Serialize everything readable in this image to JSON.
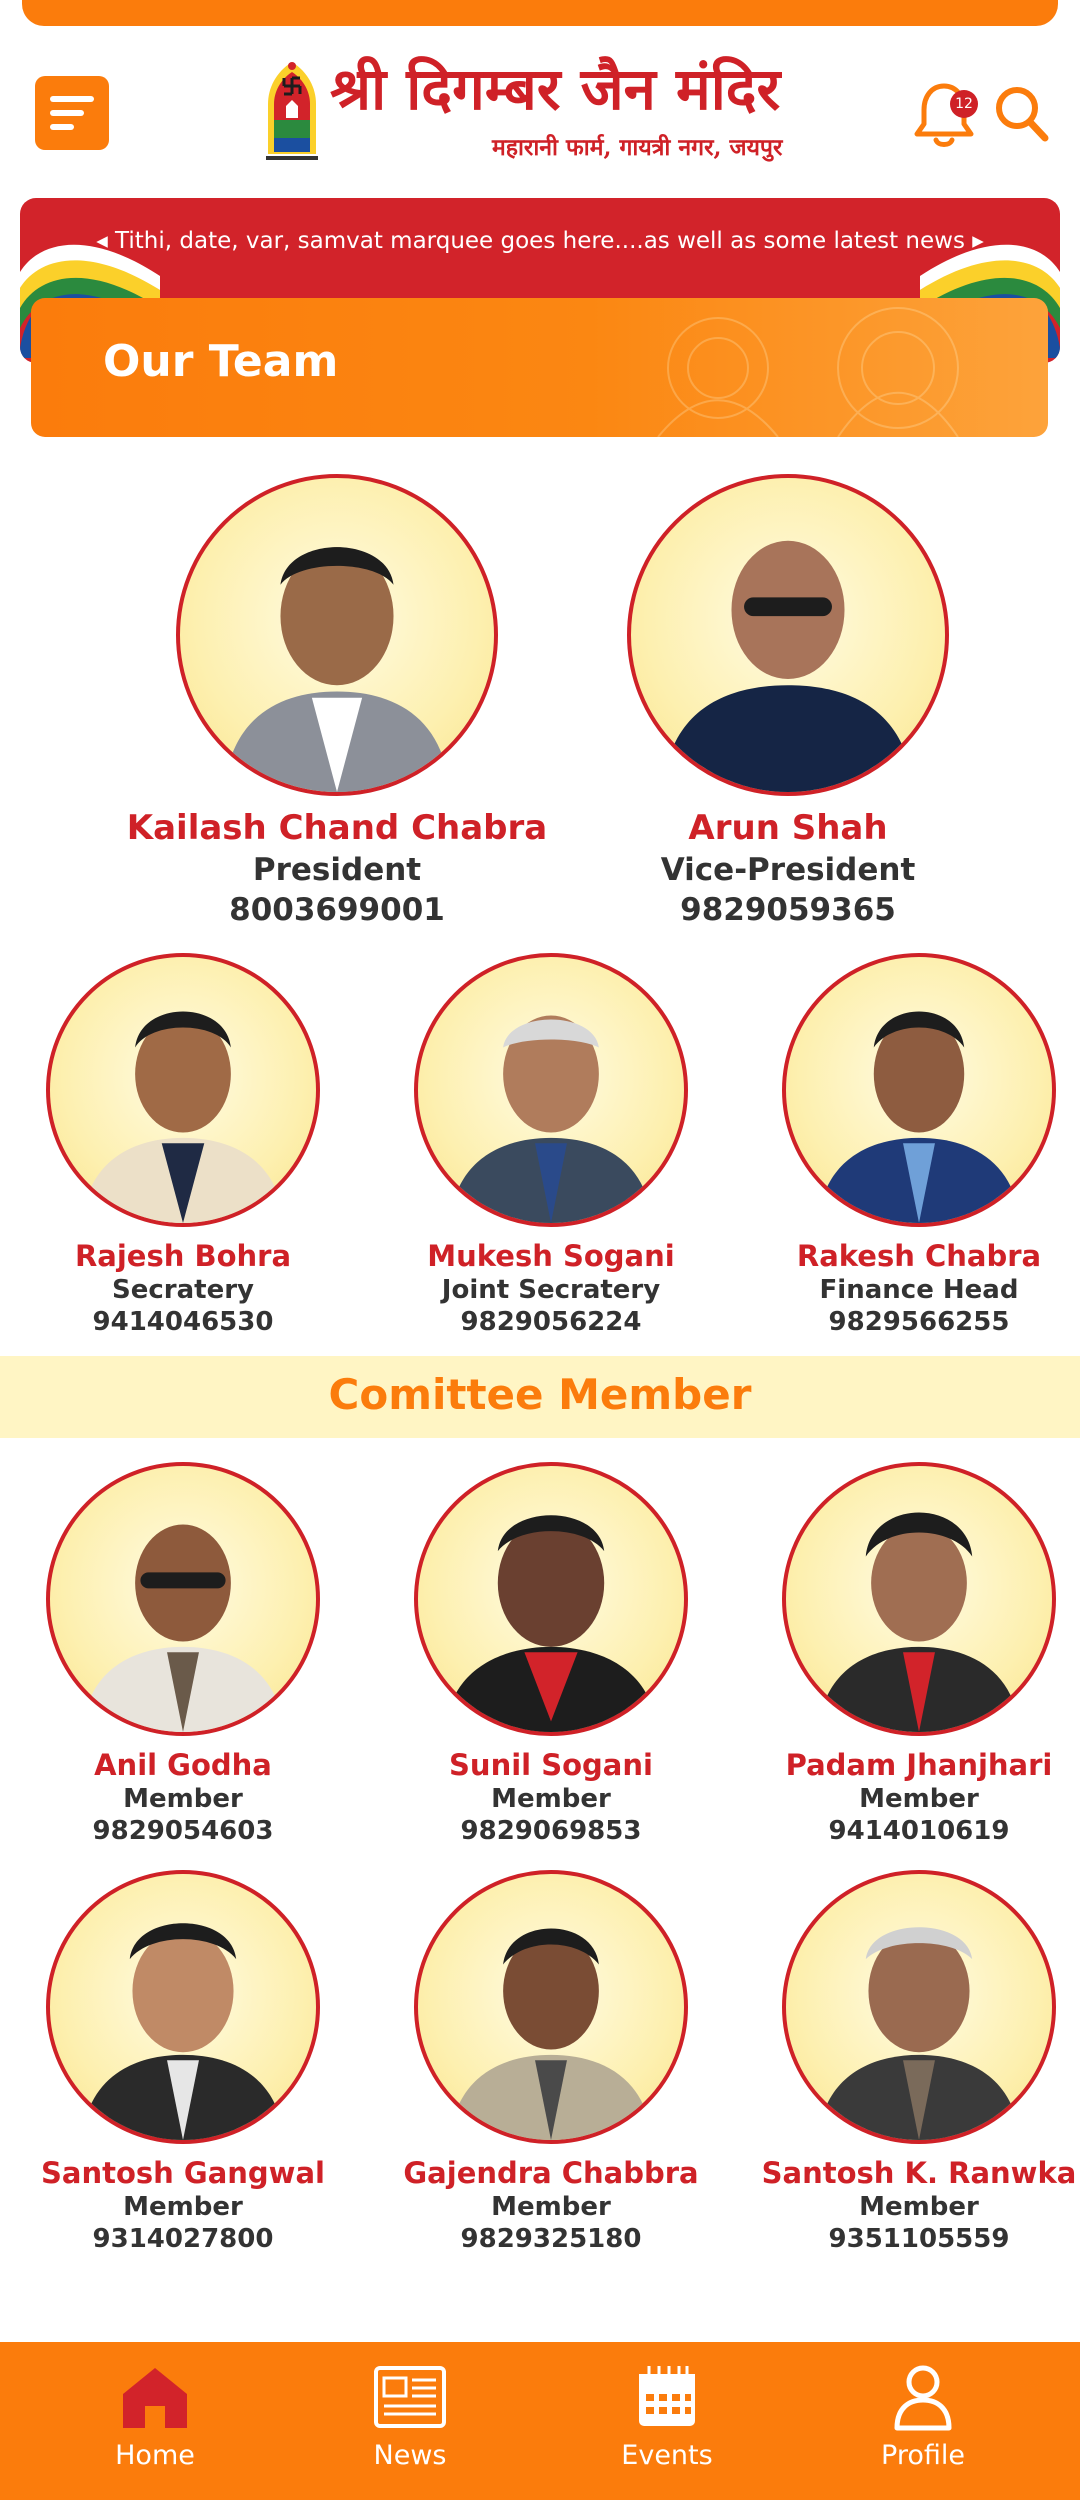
{
  "header": {
    "title": "श्री दिगम्बर जैन मंदिर",
    "subtitle": "महारानी फार्म, गायत्री नगर, जयपुर",
    "notification_count": "12",
    "menu_icon": "menu-icon",
    "bell_icon": "bell-icon",
    "search_icon": "search-icon"
  },
  "marquee": {
    "text": "◂ Tithi, date, var, samvat marquee goes here....as well as some latest news ▸"
  },
  "team": {
    "title": "Our Team",
    "leaders": [
      {
        "name": "Kailash Chand Chabra",
        "role": "President",
        "phone": "8003699001"
      },
      {
        "name": "Arun Shah",
        "role": "Vice-President",
        "phone": "9829059365"
      }
    ],
    "officers": [
      {
        "name": "Rajesh Bohra",
        "role": "Secratery",
        "phone": "9414046530"
      },
      {
        "name": "Mukesh Sogani",
        "role": "Joint Secratery",
        "phone": "9829056224"
      },
      {
        "name": "Rakesh Chabra",
        "role": "Finance Head",
        "phone": "9829566255"
      }
    ]
  },
  "committee": {
    "title": "Comittee Member",
    "members": [
      {
        "name": "Anil Godha",
        "role": "Member",
        "phone": "9829054603"
      },
      {
        "name": "Sunil Sogani",
        "role": "Member",
        "phone": "9829069853"
      },
      {
        "name": "Padam Jhanjhari",
        "role": "Member",
        "phone": "9414010619"
      },
      {
        "name": "Santosh Gangwal",
        "role": "Member",
        "phone": "9314027800"
      },
      {
        "name": "Gajendra Chabbra",
        "role": "Member",
        "phone": "9829325180"
      },
      {
        "name": "Santosh K. Ranwka",
        "role": "Member",
        "phone": "9351105559"
      }
    ]
  },
  "nav": {
    "items": [
      {
        "label": "Home",
        "icon": "home-icon"
      },
      {
        "label": "News",
        "icon": "newspaper-icon"
      },
      {
        "label": "Events",
        "icon": "calendar-icon"
      },
      {
        "label": "Profile",
        "icon": "user-icon"
      }
    ]
  },
  "colors": {
    "primary_orange": "#fb7c0c",
    "brand_red": "#cf2127",
    "band_yellow": "#fff5c4"
  }
}
